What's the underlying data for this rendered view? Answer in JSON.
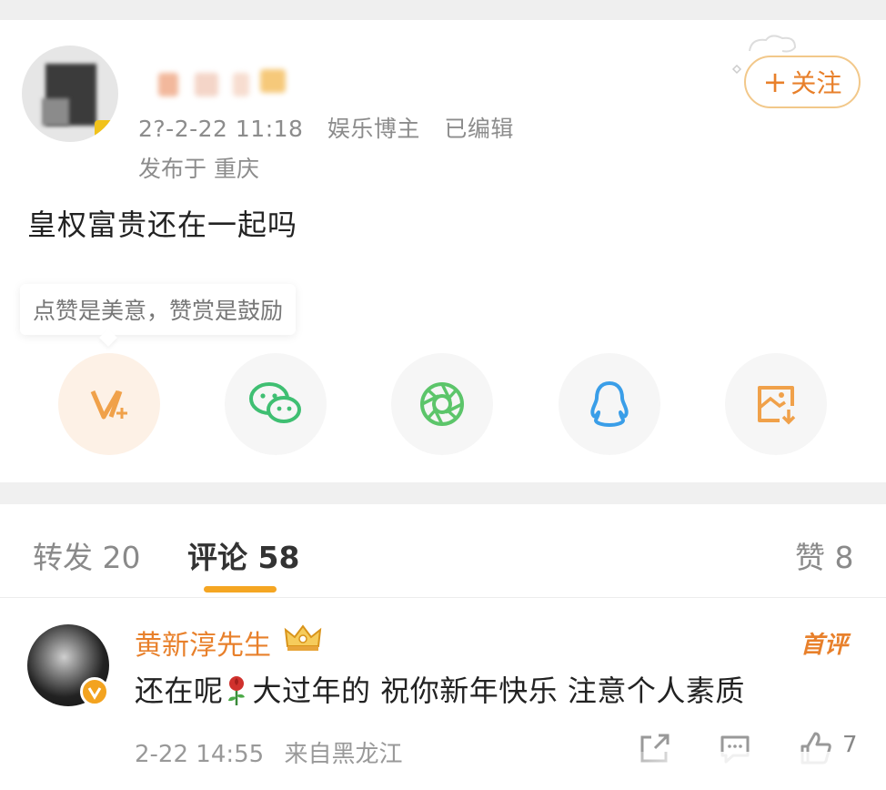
{
  "post": {
    "author_name_blurred": "",
    "time": "2?-2-22 11:18",
    "category": "娱乐博主",
    "edited": "已编辑",
    "location": "发布于 重庆",
    "follow_plus": "+",
    "follow_label": "关注",
    "text": "皇权富贵还在一起吗",
    "reward_tip": "点赞是美意，赞赏是鼓励"
  },
  "share_icons": [
    "reward-v-plus-icon",
    "wechat-icon",
    "moments-icon",
    "qq-icon",
    "save-image-icon"
  ],
  "tabs": {
    "repost": "转发 20",
    "comment": "评论 58",
    "like": "赞 8"
  },
  "comment": {
    "author": "黄新淳先生",
    "badge": "首评",
    "text_before": "还在呢",
    "text_after": "大过年的 祝你新年快乐 注意个人素质",
    "time": "2-22 14:55",
    "source": "来自黑龙江",
    "likes": "7"
  },
  "colors": {
    "accent": "#e8802b",
    "underline": "#f5a623",
    "follow_border": "#f2c88a"
  }
}
